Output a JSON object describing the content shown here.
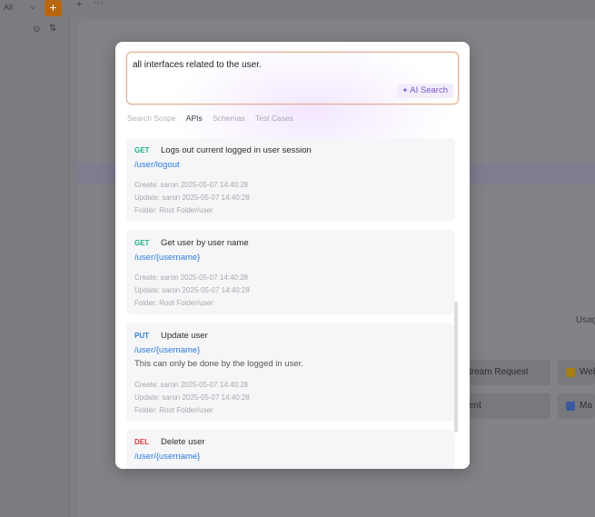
{
  "background": {
    "project_select": "All",
    "select_chevron": "⌄",
    "add_button": "+",
    "tab_add": "+",
    "tab_more": "···",
    "locate_icon": "⊙",
    "sort_icon": "⇅",
    "usage_label": "Usag",
    "cards": [
      {
        "label": "tream Request"
      },
      {
        "label": "ent"
      },
      {
        "label": "Web",
        "icon": "web-icon"
      },
      {
        "label": "Ma",
        "icon": "markdown-icon"
      }
    ]
  },
  "search": {
    "query": "all interfaces related to the user.",
    "ai_button_label": "AI Search",
    "ai_icon": "✦"
  },
  "scope": {
    "label": "Search Scope",
    "tabs": [
      {
        "label": "APIs",
        "active": true
      },
      {
        "label": "Schemas",
        "active": false
      },
      {
        "label": "Test Cases",
        "active": false
      }
    ]
  },
  "results": [
    {
      "method": "GET",
      "summary": "Logs out current logged in user session",
      "path": "/user/logout",
      "description": "",
      "create": "Create: saron 2025-05-07 14:40:28",
      "update": "Update: saron 2025-05-07 14:40:28",
      "folder": "Folder: Root Folder/user"
    },
    {
      "method": "GET",
      "summary": "Get user by user name",
      "path": "/user/{username}",
      "description": "",
      "create": "Create: saron 2025-05-07 14:40:28",
      "update": "Update: saron 2025-05-07 14:40:28",
      "folder": "Folder: Root Folder/user"
    },
    {
      "method": "PUT",
      "summary": "Update user",
      "path": "/user/{username}",
      "description": "This can only be done by the logged in user.",
      "create": "Create: saron 2025-05-07 14:40:28",
      "update": "Update: saron 2025-05-07 14:40:28",
      "folder": "Folder: Root Folder/user"
    },
    {
      "method": "DEL",
      "summary": "Delete user",
      "path": "/user/{username}",
      "description": "",
      "create": "",
      "update": "",
      "folder": ""
    }
  ],
  "colors": {
    "get": "#19b287",
    "put": "#2f7ed8",
    "del": "#d93a3a",
    "path": "#2a7ae0",
    "ai_accent": "#7a55c8",
    "add_button": "#e8861a"
  }
}
